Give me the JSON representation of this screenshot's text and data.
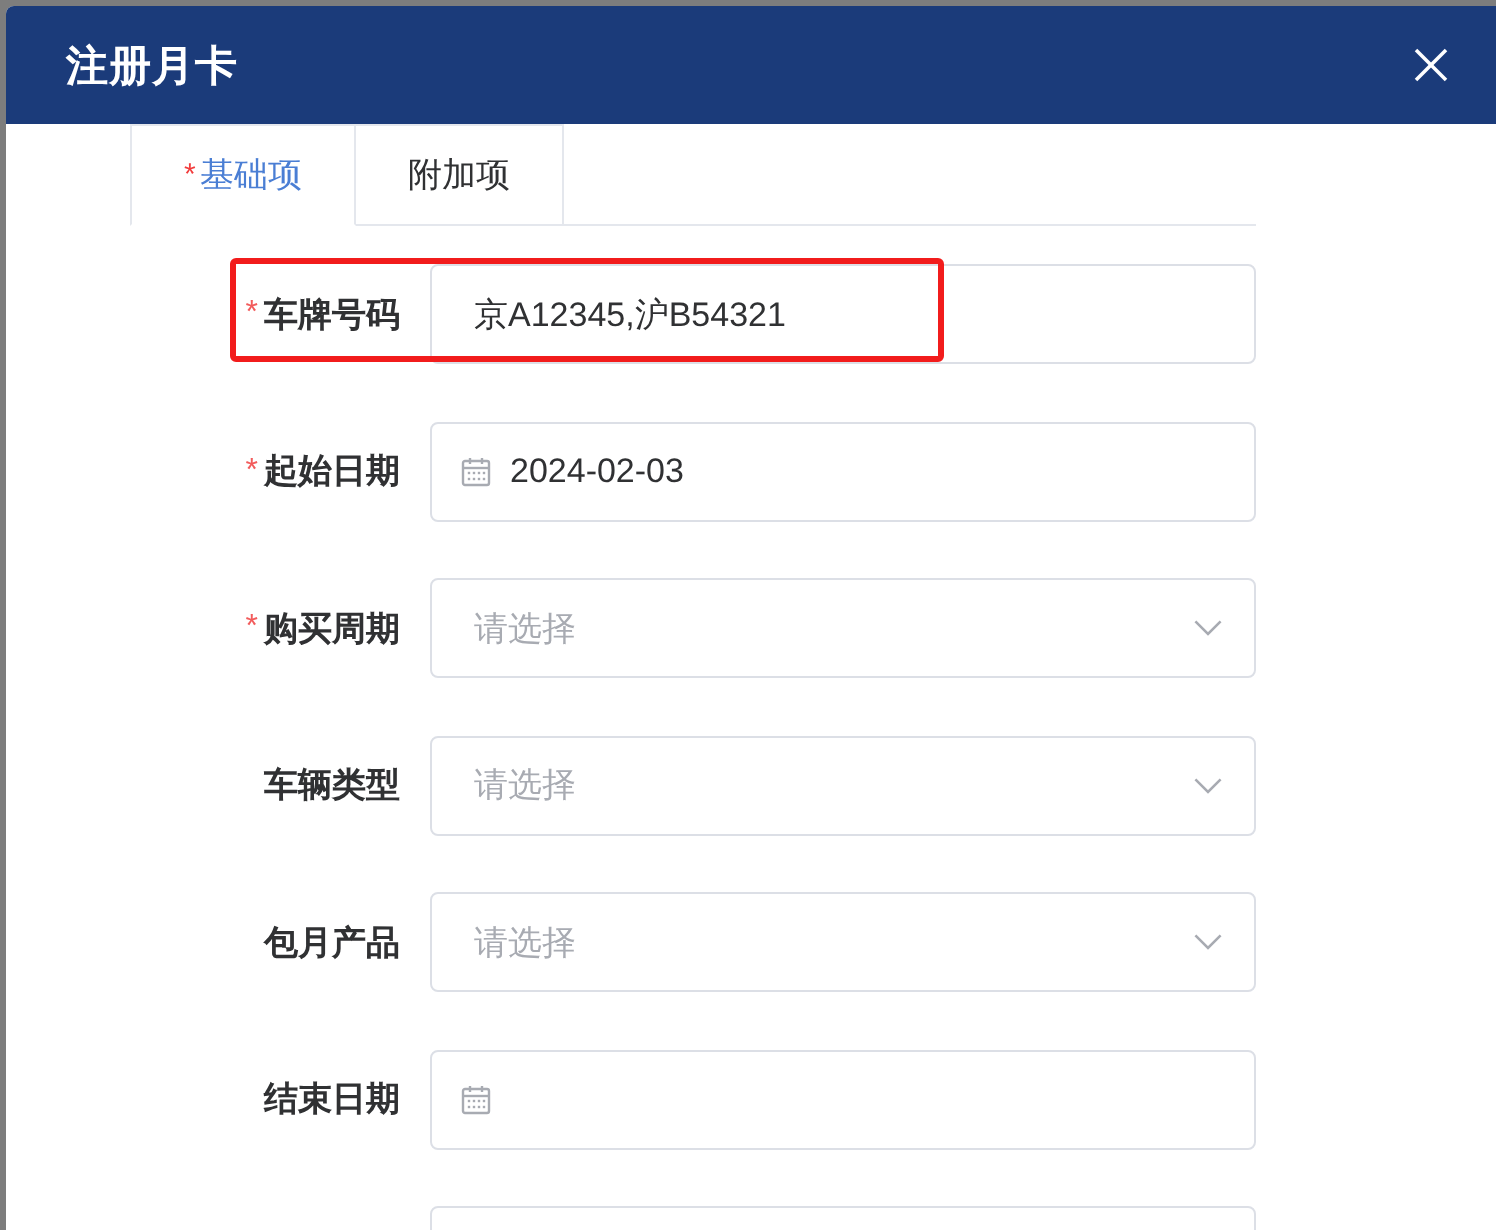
{
  "dialog": {
    "title": "注册月卡"
  },
  "tabs": [
    {
      "label": "基础项",
      "required_mark": "*",
      "selected": true
    },
    {
      "label": "附加项",
      "selected": false
    }
  ],
  "form": {
    "fields": [
      {
        "kind": "text",
        "label": "车牌号码",
        "required_mark": "*",
        "value": "京A12345,沪B54321",
        "highlighted": true
      },
      {
        "kind": "date",
        "label": "起始日期",
        "required_mark": "*",
        "value": "2024-02-03",
        "highlighted": false
      },
      {
        "kind": "select",
        "label": "购买周期",
        "required_mark": "*",
        "placeholder": "请选择",
        "highlighted": false
      },
      {
        "kind": "select",
        "label": "车辆类型",
        "placeholder": "请选择",
        "highlighted": false
      },
      {
        "kind": "select",
        "label": "包月产品",
        "placeholder": "请选择",
        "highlighted": false
      },
      {
        "kind": "date",
        "label": "结束日期",
        "highlighted": false
      },
      {
        "kind": "text",
        "highlighted": false
      }
    ]
  }
}
